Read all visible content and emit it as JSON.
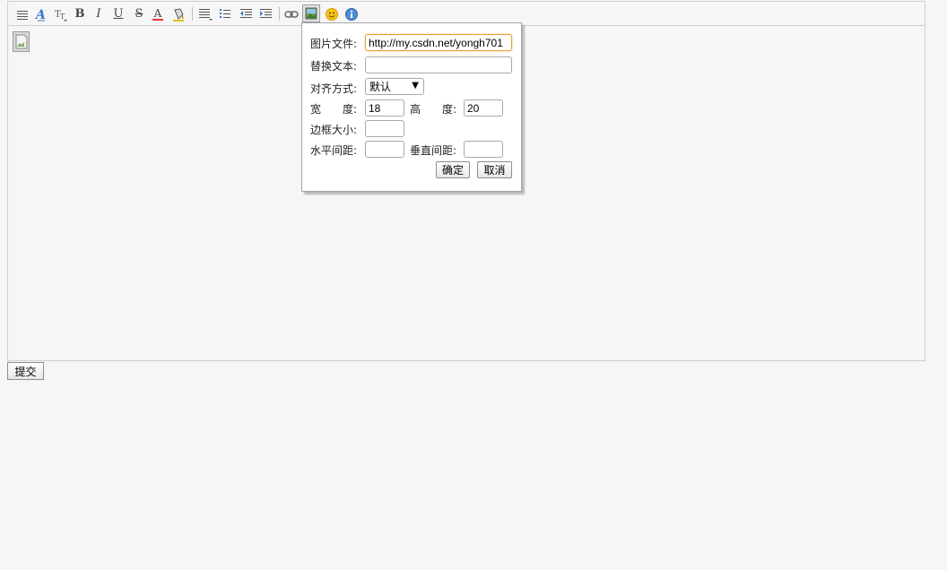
{
  "toolbar": {
    "icons": [
      "paragraph-icon",
      "font-family-icon",
      "font-size-icon",
      "bold-icon",
      "italic-icon",
      "underline-icon",
      "strikethrough-icon",
      "font-color-icon",
      "background-color-icon",
      "align-icon",
      "list-icon",
      "outdent-icon",
      "indent-icon",
      "link-icon",
      "image-icon",
      "emoticon-icon",
      "about-icon"
    ],
    "bold_glyph": "B",
    "italic_glyph": "I",
    "underline_glyph": "U",
    "strike_glyph": "S",
    "fontcolor_glyph": "A"
  },
  "image_dialog": {
    "file_label": "图片文件:",
    "file_value": "http://my.csdn.net/yongh701",
    "alt_label": "替换文本:",
    "alt_value": "",
    "align_label": "对齐方式:",
    "align_value": "默认",
    "width_label": "宽　　度:",
    "width_value": "18",
    "height_label": "高　　度:",
    "height_value": "20",
    "border_label": "边框大小:",
    "border_value": "",
    "hspace_label": "水平间距:",
    "hspace_value": "",
    "vspace_label": "垂直间距:",
    "vspace_value": "",
    "ok_label": "确定",
    "cancel_label": "取消"
  },
  "submit_label": "提交",
  "colors": {
    "background": "#f6f6f6",
    "border": "#cfcfcf",
    "focus": "#e6a23c"
  }
}
